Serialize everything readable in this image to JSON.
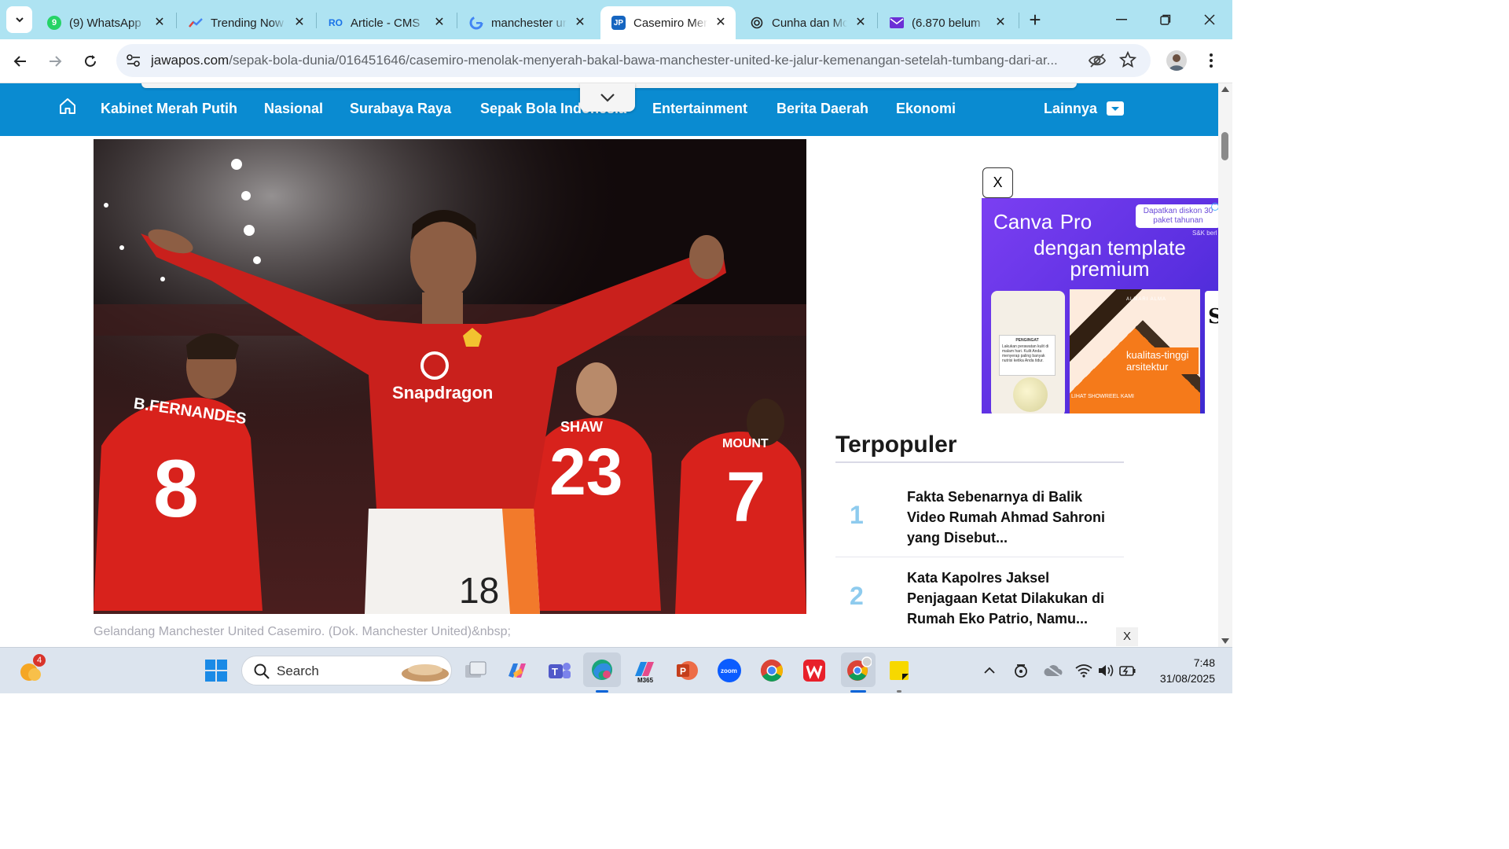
{
  "browser": {
    "tabs": [
      {
        "title": "(9) WhatsApp",
        "favicon": "whatsapp-icon",
        "badge": "9",
        "color": "#25d366"
      },
      {
        "title": "Trending Now",
        "favicon": "trends-icon",
        "color": "#4285f4"
      },
      {
        "title": "Article - CMS",
        "favicon": "cms-icon",
        "color": "#1a73e8"
      },
      {
        "title": "manchester ur",
        "favicon": "google-icon",
        "color": "#4285f4"
      },
      {
        "title": "Casemiro Mer",
        "favicon": "jawapos-icon",
        "badge": "JP",
        "color": "#1565c0",
        "active": true
      },
      {
        "title": "Cunha dan Mc",
        "favicon": "openai-icon",
        "color": "#222222"
      },
      {
        "title": "(6.870 belum",
        "favicon": "mail-icon",
        "color": "#6b2fd6"
      }
    ],
    "url_host": "jawapos.com",
    "url_path": "/sepak-bola-dunia/016451646/casemiro-menolak-menyerah-bakal-bawa-manchester-united-ke-jalur-kemenangan-setelah-tumbang-dari-ar..."
  },
  "site": {
    "nav_items": [
      "Kabinet Merah Putih",
      "Nasional",
      "Surabaya Raya",
      "Sepak Bola Indonesia",
      "Entertainment",
      "Berita Daerah",
      "Ekonomi"
    ],
    "nav_more": "Lainnya",
    "brand_color": "#0a8bd1"
  },
  "article": {
    "hero_alt": "Casemiro celebrating in red Manchester United kit",
    "jersey_sponsor": "Snapdragon",
    "jersey_names": [
      "B.FERNANDES",
      "SHAW",
      "MOUNT"
    ],
    "jersey_numbers": [
      "8",
      "23",
      "7",
      "18"
    ],
    "caption": "Gelandang Manchester United Casemiro. (Dok. Manchester United)&nbsp;"
  },
  "ad": {
    "close_label": "X",
    "brand": "Canva",
    "brand_suffix": "Pro",
    "badge": "Dapatkan diskon 30",
    "badge_line2": "paket tahunan",
    "sk": "S&K berl",
    "headline": "dengan template premium",
    "card1_note_title": "PENGINGAT",
    "card1_note_body": "Lakukan perawatan kulit di malam hari. Kulit Anda menyerap paling banyak nutrisi ketika Anda tidur.",
    "card2_logo": "ALMARI ALMA",
    "card2_text": "kualitas-tinggi arsitektur",
    "card2_link": "LIHAT SHOWREEL KAMI",
    "card3_text": "S"
  },
  "sidebar": {
    "title": "Terpopuler",
    "items": [
      {
        "rank": "1",
        "headline": "Fakta Sebenarnya di Balik Video Rumah Ahmad Sahroni yang Disebut..."
      },
      {
        "rank": "2",
        "headline": "Kata Kapolres Jaksel Penjagaan Ketat Dilakukan di Rumah Eko Patrio, Namu..."
      }
    ],
    "small_close": "X"
  },
  "taskbar": {
    "search_label": "Search",
    "notif_count": "4",
    "time": "7:48",
    "date": "31/08/2025",
    "apps": [
      "task-view-icon",
      "copilot-icon",
      "teams-icon",
      "edge-icon",
      "m365-icon",
      "powerpoint-icon",
      "zoom-icon",
      "chrome-icon",
      "wps-icon",
      "chrome-profile-icon",
      "sticky-notes-icon"
    ],
    "m365_label": "M365",
    "zoom_label": "zoom"
  }
}
